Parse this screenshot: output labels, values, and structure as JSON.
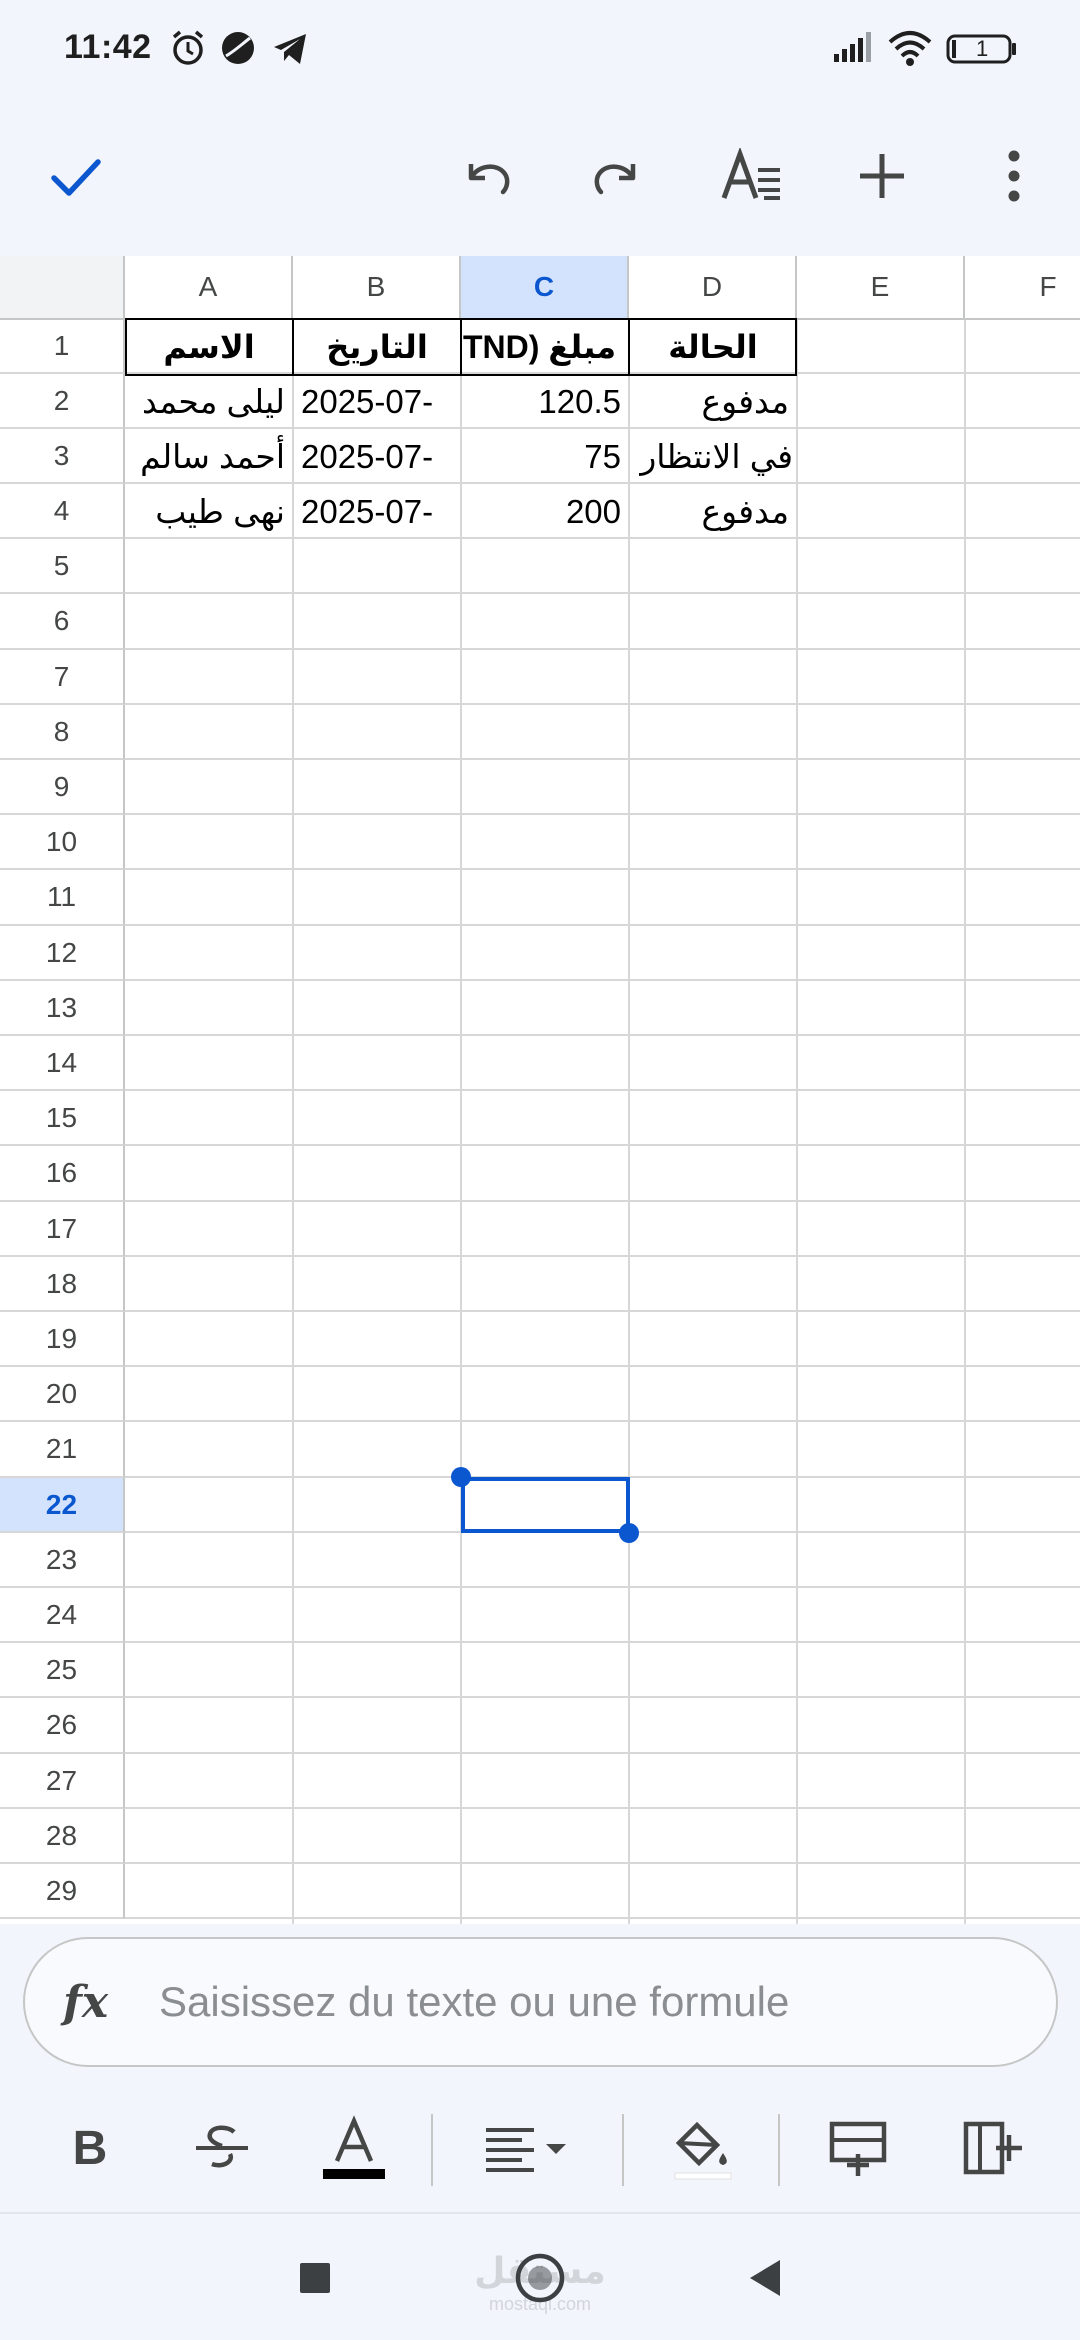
{
  "status_bar": {
    "time": "11:42",
    "left_icons": [
      "alarm-icon",
      "moon-icon",
      "telegram-icon"
    ],
    "right_icons": [
      "signal-icon",
      "wifi-icon",
      "battery-icon"
    ],
    "battery_level": "1"
  },
  "toolbar": {
    "done_icon": "check-icon",
    "undo_icon": "undo-icon",
    "redo_icon": "redo-icon",
    "text_format_icon": "text-format-icon",
    "insert_icon": "plus-icon",
    "more_icon": "more-vert-icon"
  },
  "sheet": {
    "columns": [
      "A",
      "B",
      "C",
      "D",
      "E",
      "F"
    ],
    "selected_column": "C",
    "rows": [
      "1",
      "2",
      "3",
      "4",
      "5",
      "6",
      "7",
      "8",
      "9",
      "10",
      "11",
      "12",
      "13",
      "14",
      "15",
      "16",
      "17",
      "18",
      "19",
      "20",
      "21",
      "22",
      "23",
      "24",
      "25",
      "26",
      "27",
      "28",
      "29"
    ],
    "selected_row": "22",
    "headers": {
      "A1": "الاسم",
      "B1": "التاريخ",
      "C1": "TND) مبلغ",
      "D1": "الحالة"
    },
    "data_rows": [
      {
        "name": "ليلى محمد",
        "date": "2025-07-",
        "amount": "120.5",
        "status": "مدفوع"
      },
      {
        "name": "أحمد سالم",
        "date": "2025-07-",
        "amount": "75",
        "status": "في الانتظار"
      },
      {
        "name": "نهى طيب",
        "date": "2025-07-",
        "amount": "200",
        "status": "مدفوع"
      }
    ],
    "selected_cell": "C22"
  },
  "formula_bar": {
    "fx_label": "fx",
    "placeholder": "Saisissez du texte ou une formule"
  },
  "format_bar": {
    "bold_label": "B",
    "icons": [
      "bold-icon",
      "strikethrough-icon",
      "text-color-icon",
      "align-icon",
      "fill-color-icon",
      "insert-row-icon",
      "insert-column-icon"
    ]
  },
  "nav_bar": {
    "icons": [
      "recents-icon",
      "home-icon",
      "back-icon"
    ],
    "watermark": "مستقل",
    "watermark_sub": "mostaql.com"
  },
  "colors": {
    "accent": "#0b57d0",
    "selection_fill": "#d3e3fd",
    "chrome_bg": "#f2f5fb"
  }
}
